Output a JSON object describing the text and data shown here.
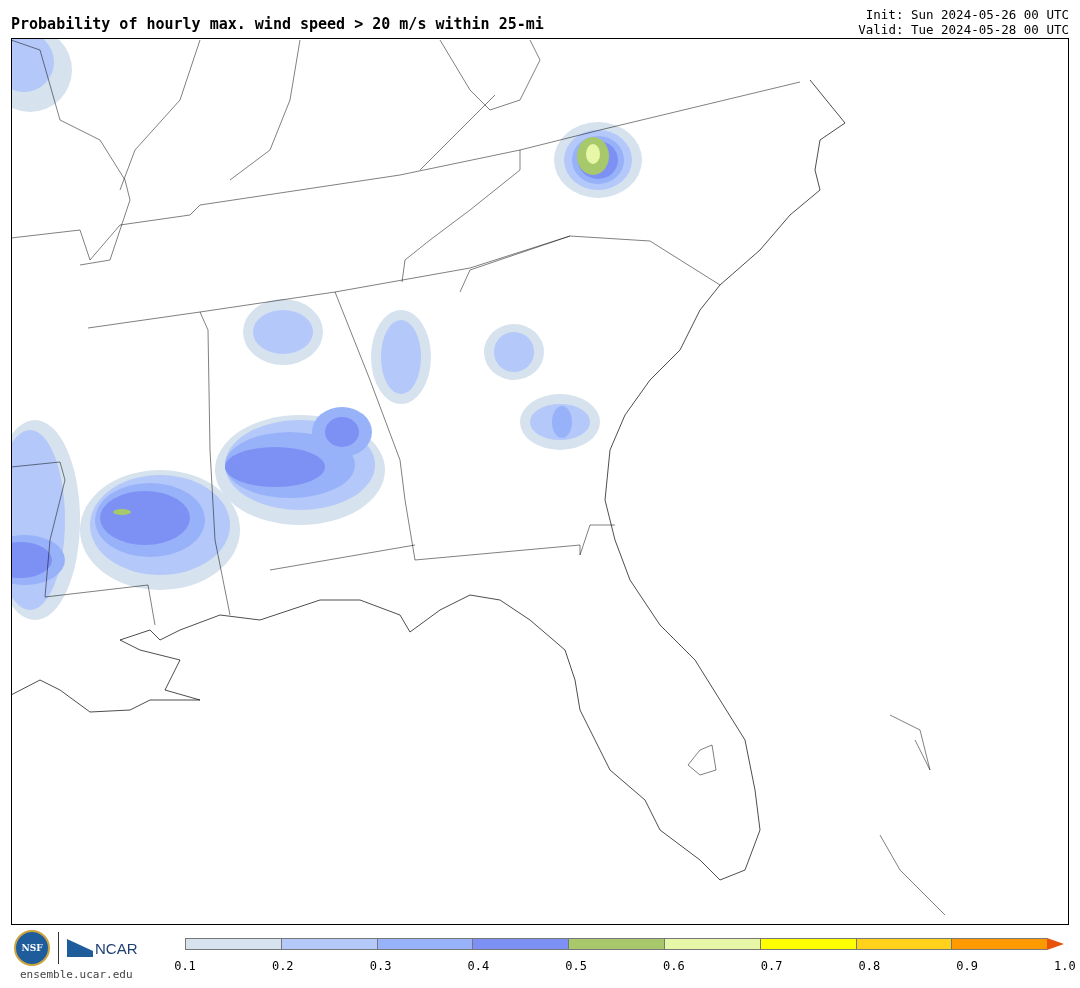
{
  "title": "Probability of hourly max. wind speed > 20 m/s within 25-mi",
  "init": "Init: Sun 2024-05-26 00 UTC",
  "valid": "Valid: Tue 2024-05-28 00 UTC",
  "footer": {
    "logo_nsf": "NSF",
    "logo_ncar": "NCAR",
    "site": "ensemble.ucar.edu"
  },
  "colorbar": {
    "bins": [
      {
        "color": "#d6e2ee"
      },
      {
        "color": "#b4c8fa"
      },
      {
        "color": "#98b2fa"
      },
      {
        "color": "#7d91f5"
      },
      {
        "color": "#a8c96b"
      },
      {
        "color": "#e6f7a8"
      },
      {
        "color": "#ffff00"
      },
      {
        "color": "#ffd11a"
      },
      {
        "color": "#ff9900"
      },
      {
        "kind": "arrow",
        "color": "#e8520a"
      }
    ],
    "ticks": [
      "0.1",
      "0.2",
      "0.3",
      "0.4",
      "0.5",
      "0.6",
      "0.7",
      "0.8",
      "0.9",
      "1.0"
    ]
  }
}
